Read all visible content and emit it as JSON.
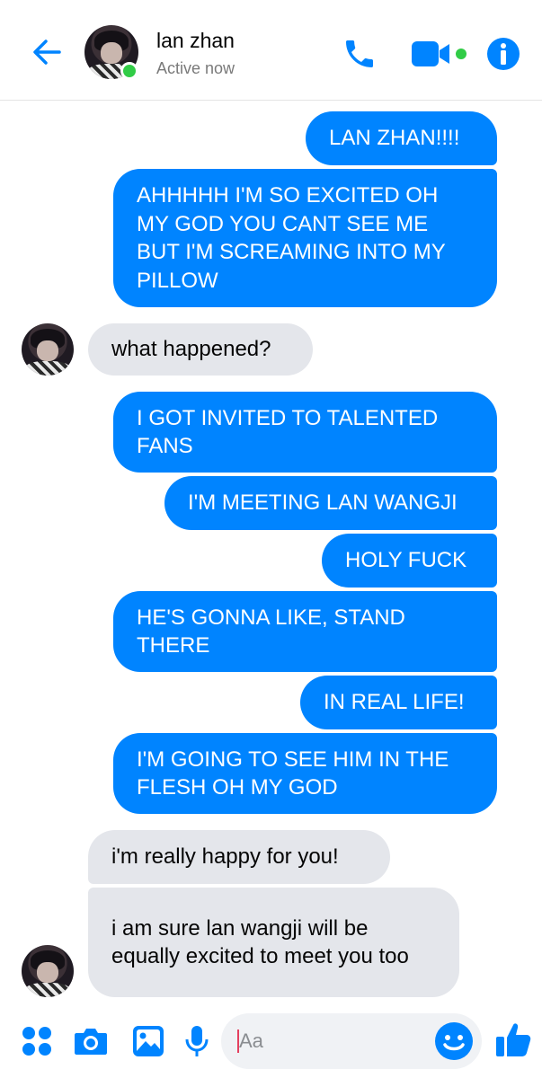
{
  "header": {
    "contact_name": "lan zhan",
    "status": "Active now"
  },
  "messages": [
    {
      "side": "out",
      "text": "LAN ZHAN!!!!"
    },
    {
      "side": "out",
      "text": "AHHHHH I'M SO EXCITED OH MY GOD YOU CANT SEE ME BUT I'M SCREAMING INTO MY PILLOW"
    },
    {
      "side": "in",
      "text": "what happened?"
    },
    {
      "side": "out",
      "text": "I GOT INVITED TO TALENTED FANS"
    },
    {
      "side": "out",
      "text": "I'M MEETING LAN WANGJI"
    },
    {
      "side": "out",
      "text": "HOLY FUCK"
    },
    {
      "side": "out",
      "text": "HE'S GONNA LIKE, STAND THERE"
    },
    {
      "side": "out",
      "text": "IN REAL LIFE!"
    },
    {
      "side": "out",
      "text": "I'M GOING TO SEE HIM IN THE FLESH OH MY GOD"
    },
    {
      "side": "in",
      "text": "i'm really happy for you!"
    },
    {
      "side": "in",
      "text": "i am sure lan wangji will be equally excited to meet you too"
    }
  ],
  "composer": {
    "placeholder": "Aa"
  },
  "colors": {
    "accent": "#0084ff",
    "incoming_bubble": "#e4e6eb",
    "online": "#31cc46"
  },
  "icons": [
    "back-arrow-icon",
    "phone-icon",
    "video-camera-icon",
    "info-icon",
    "menu-dots-icon",
    "camera-icon",
    "gallery-icon",
    "microphone-icon",
    "emoji-icon",
    "thumbs-up-icon"
  ]
}
